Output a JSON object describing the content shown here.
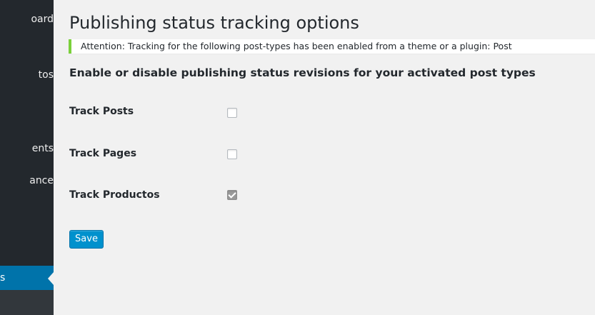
{
  "sidebar": {
    "items": [
      {
        "label": "oard"
      },
      {
        "label": "tos"
      },
      {
        "label": "ents"
      },
      {
        "label": "ance"
      },
      {
        "label": "s",
        "active": true
      }
    ]
  },
  "page": {
    "title": "Publishing status tracking options",
    "notice": "Attention: Tracking for the following post-types has been enabled from a theme or a plugin: Post",
    "section_heading": "Enable or disable publishing status revisions for your activated post types"
  },
  "options": [
    {
      "label": "Track Posts",
      "checked": false
    },
    {
      "label": "Track Pages",
      "checked": false
    },
    {
      "label": "Track Productos",
      "checked": true
    }
  ],
  "form": {
    "save_label": "Save"
  },
  "colors": {
    "sidebar_bg": "#23282d",
    "active_menu": "#0073aa",
    "notice_border": "#7ad03a",
    "button_bg": "#0091cd",
    "page_bg": "#f1f1f1"
  }
}
